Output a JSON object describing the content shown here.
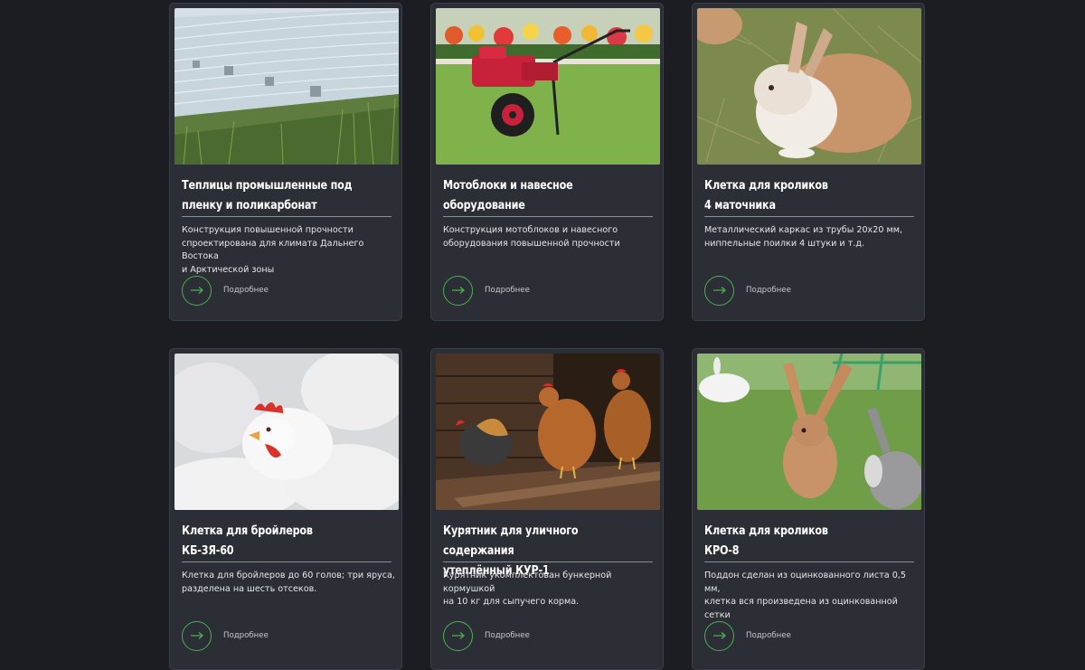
{
  "cards": [
    {
      "title_line1": "Теплицы промышленные под",
      "title_line2": "пленку и поликарбонат",
      "desc_line1": "Конструкция повышенной прочности",
      "desc_line2": "спроектирована для климата Дальнего Востока",
      "desc_line3": "и Арктической зоны",
      "more": "Подробнее",
      "image": "greenhouse-photo"
    },
    {
      "title_line1": "Мотоблоки и навесное",
      "title_line2": "оборудование",
      "desc_line1": "Конструкция мотоблоков и навесного",
      "desc_line2": "оборудования повышенной прочности",
      "desc_line3": "",
      "more": "Подробнее",
      "image": "walk-behind-tractor-photo"
    },
    {
      "title_line1": "Клетка для кроликов",
      "title_line2": "4 маточника",
      "desc_line1": "Металлический каркас из трубы 20x20 мм,",
      "desc_line2": "ниппельные поилки 4 штуки и т.д.",
      "desc_line3": "",
      "more": "Подробнее",
      "image": "rabbit-photo"
    },
    {
      "title_line1": "Клетка для бройлеров",
      "title_line2": "КБ-3Я-60",
      "desc_line1": "Клетка для бройлеров до 60 голов; три яруса,",
      "desc_line2": "разделена на шесть отсеков.",
      "desc_line3": "",
      "more": "Подробнее",
      "image": "broiler-chicken-photo"
    },
    {
      "title_line1": "Курятник для уличного содержания",
      "title_line2": "утеплённый КУР-1",
      "desc_line1": "Курятник укомплектован бункерной кормушкой",
      "desc_line2": "на 10 кг для сыпучего корма.",
      "desc_line3": "",
      "more": "Подробнее",
      "image": "chicken-coop-photo"
    },
    {
      "title_line1": "Клетка для кроликов",
      "title_line2": "КРО-8",
      "desc_line1": "Поддон сделан из оцинкованного листа 0,5 мм,",
      "desc_line2": "клетка вся произведена из оцинкованной",
      "desc_line3": "сетки",
      "more": "Подробнее",
      "image": "rabbits-on-grass-photo"
    }
  ],
  "colors": {
    "background": "#1c1d22",
    "card": "#2c2e35",
    "accent": "#4caf50"
  },
  "icons": {
    "more": "arrow-right-icon"
  }
}
